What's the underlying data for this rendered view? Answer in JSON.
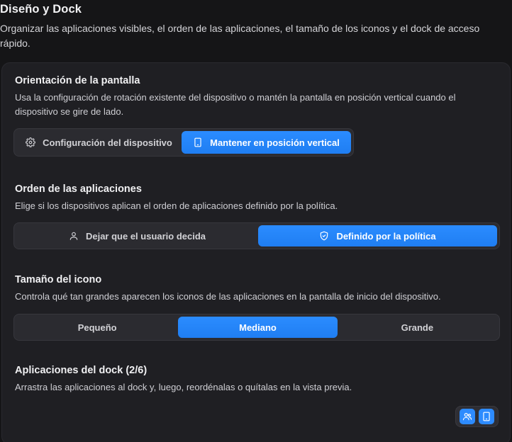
{
  "header": {
    "title": "Diseño y Dock",
    "description": "Organizar las aplicaciones visibles, el orden de las aplicaciones, el tamaño de los iconos y el dock de acceso rápido."
  },
  "orientation": {
    "title": "Orientación de la pantalla",
    "description": "Usa la configuración de rotación existente del dispositivo o mantén la pantalla en posición vertical cuando el dispositivo se gire de lado.",
    "options": [
      {
        "label": "Configuración del dispositivo",
        "icon": "gear-icon",
        "selected": false
      },
      {
        "label": "Mantener en posición vertical",
        "icon": "tablet-icon",
        "selected": true
      }
    ]
  },
  "app_order": {
    "title": "Orden de las aplicaciones",
    "description": "Elige si los dispositivos aplican el orden de aplicaciones definido por la política.",
    "options": [
      {
        "label": "Dejar que el usuario decida",
        "icon": "user-icon",
        "selected": false
      },
      {
        "label": "Definido por la política",
        "icon": "shield-icon",
        "selected": true
      }
    ]
  },
  "icon_size": {
    "title": "Tamaño del icono",
    "description": "Controla qué tan grandes aparecen los iconos de las aplicaciones en la pantalla de inicio del dispositivo.",
    "options": [
      {
        "label": "Pequeño",
        "selected": false
      },
      {
        "label": "Mediano",
        "selected": true
      },
      {
        "label": "Grande",
        "selected": false
      }
    ]
  },
  "dock": {
    "title": "Aplicaciones del dock (2/6)",
    "description": "Arrastra las aplicaciones al dock y, luego, reordénalas o quítalas en la vista previa."
  },
  "floating_actions": [
    {
      "icon": "users-icon"
    },
    {
      "icon": "tablet-icon"
    }
  ],
  "colors": {
    "accent": "#2b8cff",
    "background": "#151517",
    "card": "#1f1f23"
  }
}
